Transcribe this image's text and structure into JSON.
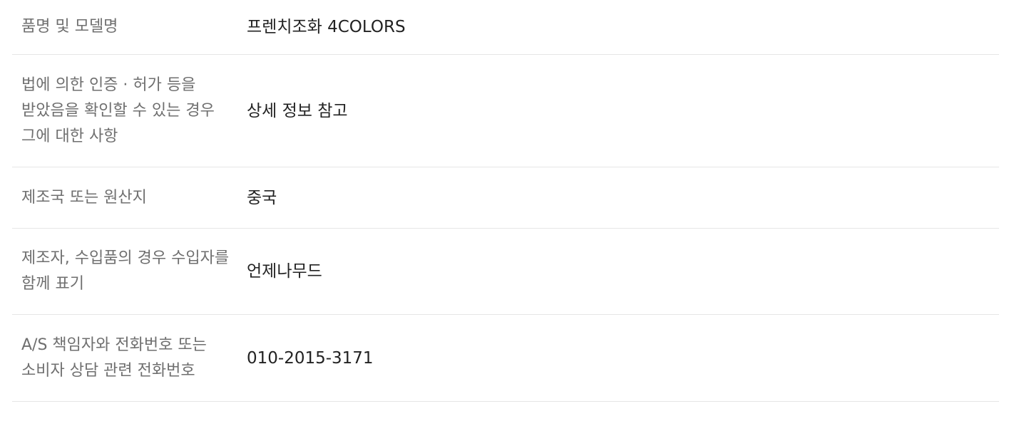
{
  "product_info": {
    "rows": [
      {
        "label": "품명 및 모델명",
        "value": "프렌치조화 4COLORS"
      },
      {
        "label": "법에 의한 인증 · 허가 등을 받았음을 확인할 수 있는 경우 그에 대한 사항",
        "value": "상세 정보 참고"
      },
      {
        "label": "제조국 또는 원산지",
        "value": "중국"
      },
      {
        "label": "제조자, 수입품의 경우 수입자를 함께 표기",
        "value": "언제나무드"
      },
      {
        "label": "A/S 책임자와 전화번호 또는 소비자 상담 관련 전화번호",
        "value": "010-2015-3171"
      }
    ]
  }
}
